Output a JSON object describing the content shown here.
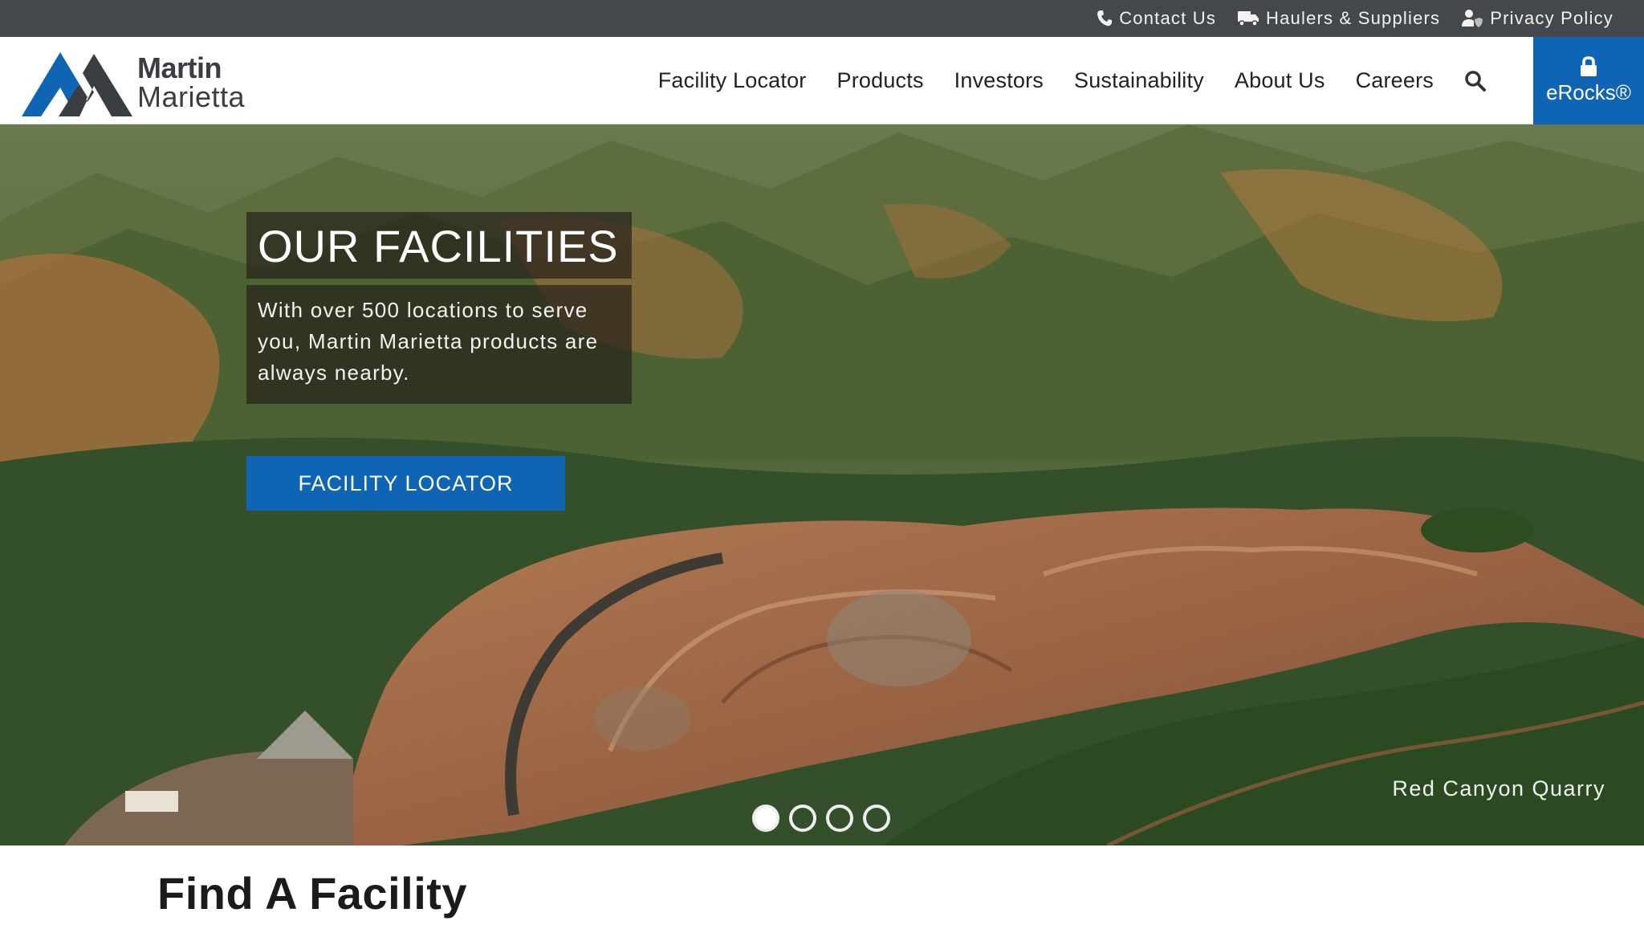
{
  "utility": {
    "contact": "Contact Us",
    "haulers": "Haulers & Suppliers",
    "privacy": "Privacy Policy"
  },
  "logo": {
    "line1": "Martin",
    "line2": "Marietta"
  },
  "nav": {
    "items": [
      "Facility Locator",
      "Products",
      "Investors",
      "Sustainability",
      "About Us",
      "Careers"
    ],
    "erocks": "eRocks®"
  },
  "hero": {
    "title": "OUR FACILITIES",
    "subtitle": "With over 500 locations to serve you, Martin Marietta products are always nearby.",
    "cta": "FACILITY LOCATOR",
    "caption": "Red Canyon Quarry",
    "slides_total": 4,
    "active_slide": 1
  },
  "section": {
    "title": "Find A Facility"
  },
  "colors": {
    "brand_blue": "#1064b4",
    "utility_bar": "#44484d"
  },
  "icons": [
    "phone-icon",
    "truck-icon",
    "user-shield-icon",
    "search-icon",
    "lock-icon"
  ]
}
